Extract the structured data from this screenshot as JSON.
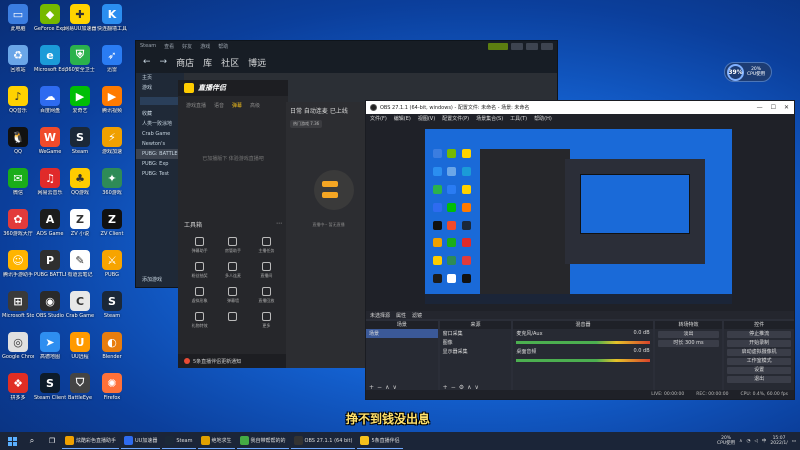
{
  "desktop": {
    "icons": [
      {
        "label": "此电脑",
        "color": "#3b7de0",
        "glyph": "▭"
      },
      {
        "label": "GeForce Experience",
        "color": "#76b900",
        "glyph": "◆"
      },
      {
        "label": "网易UU加速器",
        "color": "#ffd400",
        "glyph": "✚"
      },
      {
        "label": "快连翻墙工具",
        "color": "#2b8ef0",
        "glyph": "K"
      },
      {
        "label": "回收站",
        "color": "#6aa6e8",
        "glyph": "♻"
      },
      {
        "label": "Microsoft Edge",
        "color": "#1b9bd8",
        "glyph": "e"
      },
      {
        "label": "360安全卫士",
        "color": "#2bb24c",
        "glyph": "⛨"
      },
      {
        "label": "迅雷",
        "color": "#2a7cf3",
        "glyph": "➶"
      },
      {
        "label": "QQ音乐",
        "color": "#ffd200",
        "glyph": "♪"
      },
      {
        "label": "百度网盘",
        "color": "#2e6bf0",
        "glyph": "☁"
      },
      {
        "label": "爱奇艺",
        "color": "#00be06",
        "glyph": "▶"
      },
      {
        "label": "腾讯视频",
        "color": "#ff7a00",
        "glyph": "▶"
      },
      {
        "label": "QQ",
        "color": "#111111",
        "glyph": "🐧"
      },
      {
        "label": "WeGame",
        "color": "#f04a2a",
        "glyph": "W"
      },
      {
        "label": "Steam",
        "color": "#1b2838",
        "glyph": "S"
      },
      {
        "label": "游戏加速",
        "color": "#f0a000",
        "glyph": "⚡"
      },
      {
        "label": "微信",
        "color": "#1aad19",
        "glyph": "✉"
      },
      {
        "label": "网易云音乐",
        "color": "#e02a2a",
        "glyph": "♫"
      },
      {
        "label": "QQ游戏",
        "color": "#ffcc00",
        "glyph": "♣"
      },
      {
        "label": "360游戏",
        "color": "#2e8b57",
        "glyph": "✦"
      },
      {
        "label": "360游戏大厅",
        "color": "#e23b3b",
        "glyph": "✿"
      },
      {
        "label": "ADS Game",
        "color": "#1c1c1c",
        "glyph": "A"
      },
      {
        "label": "ZV 小说",
        "color": "#ffffff",
        "glyph": "Z"
      },
      {
        "label": "ZV Client",
        "color": "#111111",
        "glyph": "Z"
      },
      {
        "label": "腾讯手游助手",
        "color": "#ffb400",
        "glyph": "☺"
      },
      {
        "label": "PUBG BATTLEGROUNDS",
        "color": "#2f2f2f",
        "glyph": "P"
      },
      {
        "label": "有道云笔记",
        "color": "#ffffff",
        "glyph": "✎"
      },
      {
        "label": "PUBG",
        "color": "#f7a400",
        "glyph": "⚔"
      },
      {
        "label": "Microsoft Store",
        "color": "#3a3a3a",
        "glyph": "⊞"
      },
      {
        "label": "OBS Studio",
        "color": "#2a2a2a",
        "glyph": "◉"
      },
      {
        "label": "Crab Game",
        "color": "#e8e8e8",
        "glyph": "C"
      },
      {
        "label": "Steam",
        "color": "#1b2838",
        "glyph": "S"
      },
      {
        "label": "Google Chrome",
        "color": "#e0e0e0",
        "glyph": "◎"
      },
      {
        "label": "高德地图",
        "color": "#2e8ef0",
        "glyph": "➤"
      },
      {
        "label": "UU远程",
        "color": "#ff9a00",
        "glyph": "U"
      },
      {
        "label": "Blender",
        "color": "#e87d0d",
        "glyph": "◐"
      },
      {
        "label": "拼多多",
        "color": "#e02e24",
        "glyph": "❖"
      },
      {
        "label": "Steam Client",
        "color": "#0d1b2a",
        "glyph": "S"
      },
      {
        "label": "BattleEye",
        "color": "#444444",
        "glyph": "⛉"
      },
      {
        "label": "Firefox",
        "color": "#ff7139",
        "glyph": "✺"
      }
    ]
  },
  "cpu_widget": {
    "value": "39%",
    "label1": "20%",
    "label2": "CPU使用"
  },
  "steam": {
    "title": "Steam",
    "menu": [
      "Steam",
      "查看",
      "好友",
      "游戏",
      "帮助"
    ],
    "nav": [
      "商店",
      "库",
      "社区",
      "博远"
    ],
    "sidebar_rows": [
      "主页",
      "游戏",
      "收藏",
      "人类一败涂地",
      "Crab Game",
      "Newton's",
      "PUBG: BATTLEGROUNDS",
      "PUBG: Exp",
      "PUBG: Test"
    ],
    "add_game": "添加游戏"
  },
  "helper": {
    "title": "直播伴侣",
    "tabs": [
      "游戏直播",
      "语音",
      "弹幕",
      "高级"
    ],
    "empty_text": "已加播版下 体验游戏直播吧",
    "tools_header": "工具箱",
    "tools": [
      "弹幕助手",
      "房管助手",
      "主播任务",
      "粉丝抽奖",
      "多人连麦",
      "直播间",
      "虚拟形象",
      "弹幕墙",
      "直播回放",
      "礼物特效",
      "",
      "更多"
    ],
    "footer": "5条直播伴侣更新通知"
  },
  "stream_panel": {
    "header": "日常 自动连麦 已上线",
    "chip": "热门游戏 7.36",
    "empty": "直播中-- 暂无直播"
  },
  "obs": {
    "title": "OBS 27.1.1 (64-bit, windows) - 配置文件: 未命名 - 场景: 未命名",
    "menu": [
      "文件(F)",
      "编辑(E)",
      "视图(V)",
      "配置文件(P)",
      "场景集合(S)",
      "工具(T)",
      "帮助(H)"
    ],
    "scene_bar": [
      "未选择源",
      "属性",
      "滤镜"
    ],
    "docks": {
      "scenes": {
        "title": "场景",
        "items": [
          "场景"
        ]
      },
      "sources": {
        "title": "来源",
        "items": [
          "窗口采集",
          "图像",
          "显示器采集"
        ]
      },
      "mixer": {
        "title": "混音器",
        "items": [
          "麦克风/Aux",
          "桌面音频"
        ],
        "levels": [
          "0.0 dB",
          "0.0 dB"
        ]
      },
      "transitions": {
        "title": "转场特效",
        "items": [
          "淡出",
          "时长 300 ms"
        ]
      },
      "controls": {
        "title": "控件",
        "items": [
          "停止推流",
          "开始录制",
          "启动虚拟摄像机",
          "工作室模式",
          "设置",
          "退出"
        ]
      }
    },
    "status": [
      "LIVE: 00:00:00",
      "REC: 00:00:00",
      "CPU: 0.4%, 60.00 fps"
    ]
  },
  "caption": "挣不到钱没出息",
  "taskbar": {
    "items": [
      {
        "label": "炫酷彩色直播助手",
        "color": "#f0a000"
      },
      {
        "label": "UU加速器",
        "color": "#2e6bf0"
      },
      {
        "label": "Steam",
        "color": "#1b2838"
      },
      {
        "label": "绝地求生",
        "color": "#e0a000"
      },
      {
        "label": "我自带帮帮的的",
        "color": "#44aa44"
      },
      {
        "label": "OBS 27.1.1 (64 bit)",
        "color": "#333333"
      },
      {
        "label": "5条直播伴侣",
        "color": "#f7c21b"
      }
    ],
    "tray_cpu": "20%",
    "tray_cpu_label": "CPU使用",
    "clock_time": "15:07",
    "clock_date": "2022/1/"
  }
}
